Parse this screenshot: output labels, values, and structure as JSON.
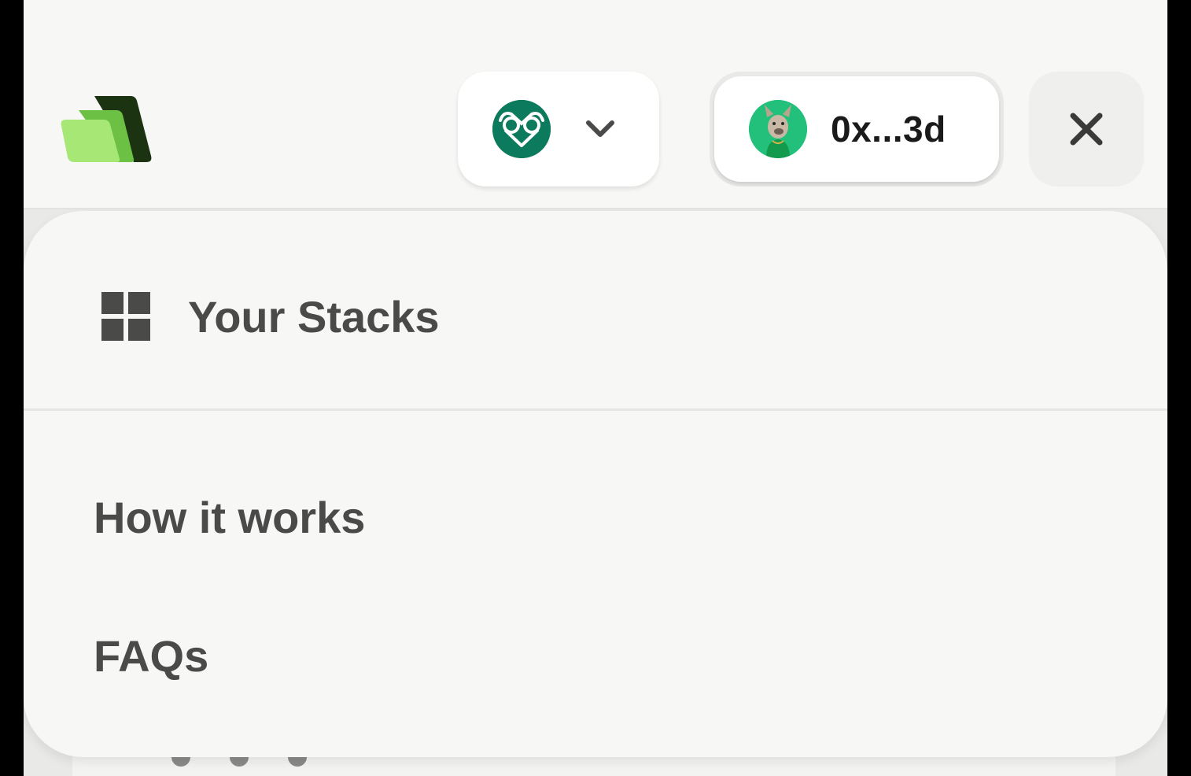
{
  "header": {
    "logo_icon": "stacked-folders-logo-icon",
    "chain_selector": {
      "icon": "gnosis-owl-icon",
      "chevron_icon": "chevron-down-icon",
      "brand_color": "#0c7a5c"
    },
    "wallet": {
      "avatar_icon": "dog-avatar-icon",
      "address": "0x...3d"
    },
    "close_icon": "close-icon"
  },
  "menu": {
    "items": [
      {
        "label": "Your Stacks",
        "icon": "grid-icon"
      },
      {
        "label": "How it works"
      },
      {
        "label": "FAQs"
      }
    ]
  },
  "colors": {
    "background": "#f7f7f5",
    "menu_text": "#4a4a48",
    "logo_light_green": "#a6e776",
    "logo_mid_green": "#6cc043",
    "logo_dark_green": "#1c3312"
  }
}
